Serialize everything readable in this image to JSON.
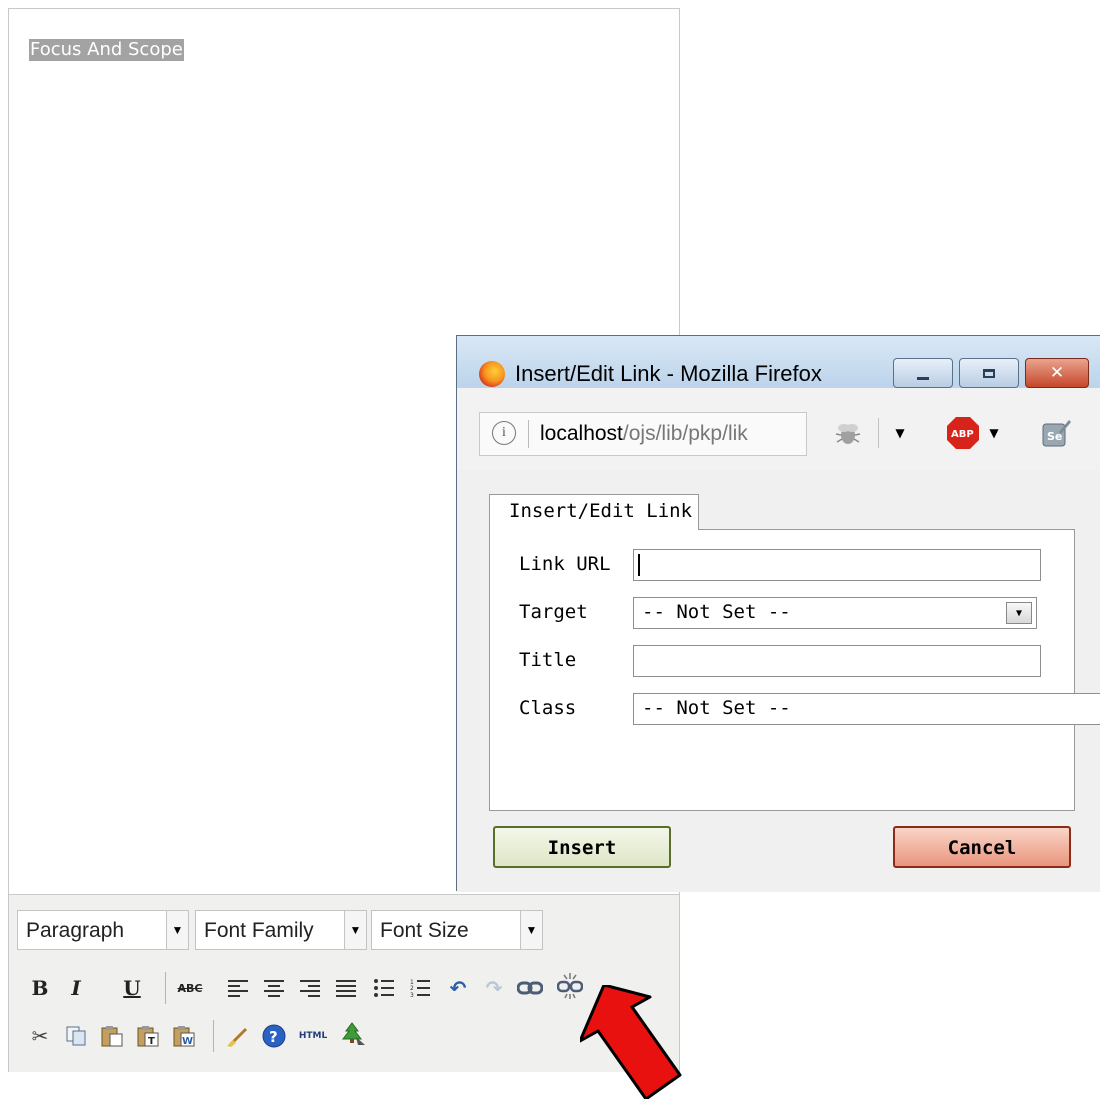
{
  "editor": {
    "content_text": "Focus And Scope",
    "format_select": "Paragraph",
    "font_family_select": "Font Family",
    "font_size_select": "Font Size",
    "toolbar_row1_icons": [
      "bold-icon",
      "italic-icon",
      "underline-icon",
      "strikethrough-icon",
      "align-left-icon",
      "align-center-icon",
      "align-right-icon",
      "align-justify-icon",
      "bullet-list-icon",
      "numbered-list-icon",
      "undo-icon",
      "redo-icon",
      "link-icon",
      "unlink-icon"
    ],
    "toolbar_row2_icons": [
      "cut-icon",
      "copy-icon",
      "paste-icon",
      "paste-text-icon",
      "paste-word-icon",
      "cleanup-icon",
      "help-icon",
      "html-icon",
      "image-icon"
    ],
    "bold_label": "B",
    "italic_label": "I",
    "underline_label": "U",
    "strike_label": "ABC",
    "html_label": "HTML"
  },
  "dialog": {
    "window_title": "Insert/Edit Link - Mozilla Firefox",
    "url_host": "localhost",
    "url_path": "/ojs/lib/pkp/lik",
    "abp_label": "ABP",
    "tab_label": "Insert/Edit Link",
    "fields": {
      "link_url_label": "Link URL",
      "link_url_value": "",
      "target_label": "Target",
      "target_value": "-- Not Set --",
      "title_label": "Title",
      "title_value": "",
      "class_label": "Class",
      "class_value": "-- Not Set --"
    },
    "insert_button": "Insert",
    "cancel_button": "Cancel"
  },
  "annotation": {
    "arrow_color": "#e8110f"
  }
}
